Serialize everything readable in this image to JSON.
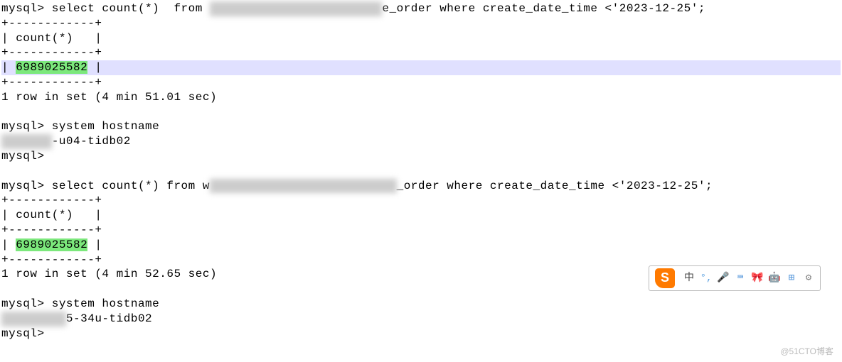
{
  "query1": {
    "prompt": "mysql> ",
    "sql_pre": "select count(*)  from ",
    "sql_redacted": "xxxxxxxxxxxxxxxxxxxxxxxx",
    "sql_post": "e_order where create_date_time <'2023-12-25';",
    "border": "+------------+",
    "header": "| count(*)   |",
    "value_pre": "| ",
    "value": "6989025582",
    "value_post": " |",
    "timing": "1 row in set (4 min 51.01 sec)"
  },
  "host1": {
    "cmd_prompt": "mysql> ",
    "cmd": "system hostname",
    "redacted": "xxxxxxx",
    "tail": "-u04-tidb02",
    "prompt2": "mysql> "
  },
  "query2": {
    "prompt": "mysql> ",
    "sql_pre": "select count(*) from w",
    "sql_redacted": "xxxxxxxxxxxxxxxxxxxxxxxxxx",
    "sql_post": "_order where create_date_time <'2023-12-25';",
    "border": "+------------+",
    "header": "| count(*)   |",
    "value_pre": "| ",
    "value": "6989025582",
    "value_post": " |",
    "timing": "1 row in set (4 min 52.65 sec)"
  },
  "host2": {
    "cmd_prompt": "mysql> ",
    "cmd": "system hostname",
    "redacted": "xxxxxxxxx",
    "tail": "5-34u-tidb02",
    "prompt2": "mysql>"
  },
  "toolbar": {
    "badge": "S",
    "zh": "中",
    "items": [
      "°,",
      "🎤",
      "⌨",
      "🎀",
      "🤖",
      "⊞",
      "⚙"
    ]
  },
  "watermark": "@51CTO博客"
}
